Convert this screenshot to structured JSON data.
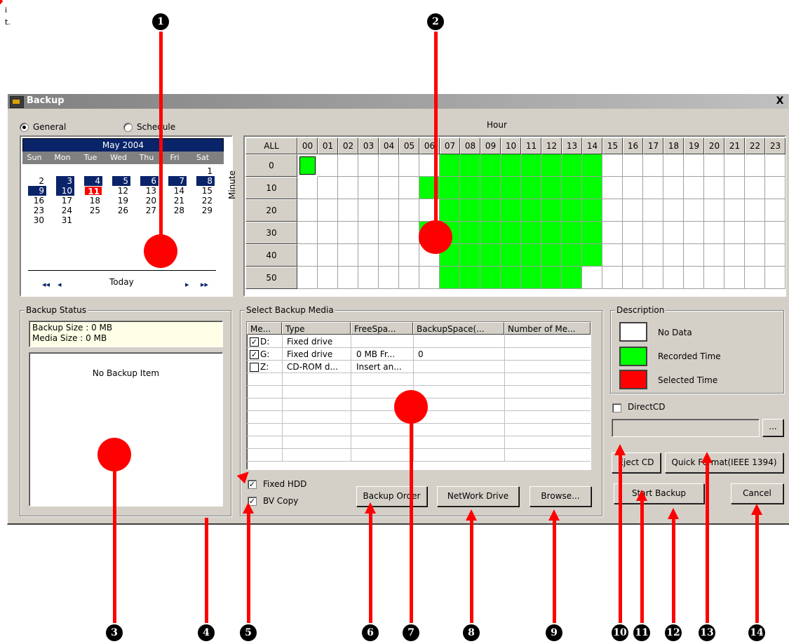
{
  "margin_note": "it.",
  "window": {
    "title": "Backup",
    "close_label": "X"
  },
  "mode": {
    "general_label": "General",
    "schedule_label": "Schedule",
    "selected": "General"
  },
  "calendar": {
    "month_label": "May 2004",
    "weekdays": [
      "Sun",
      "Mon",
      "Tue",
      "Wed",
      "Thu",
      "Fri",
      "Sat"
    ],
    "weeks": [
      [
        "",
        "",
        "",
        "",
        "",
        "",
        "1"
      ],
      [
        "2",
        "3",
        "4",
        "5",
        "6",
        "7",
        "8"
      ],
      [
        "9",
        "10",
        "11",
        "12",
        "13",
        "14",
        "15"
      ],
      [
        "16",
        "17",
        "18",
        "19",
        "20",
        "21",
        "22"
      ],
      [
        "23",
        "24",
        "25",
        "26",
        "27",
        "28",
        "29"
      ],
      [
        "30",
        "31",
        "",
        "",
        "",
        "",
        ""
      ]
    ],
    "selected_days": [
      "3",
      "4",
      "5",
      "6",
      "7",
      "8",
      "9",
      "10"
    ],
    "today": "11",
    "today_label": "Today",
    "nav": {
      "first": "◂◂",
      "prev": "◂",
      "next": "▸",
      "last": "▸▸"
    }
  },
  "hour_grid": {
    "hour_label": "Hour",
    "minute_label": "Minute",
    "all_label": "ALL",
    "hours": [
      "00",
      "01",
      "02",
      "03",
      "04",
      "05",
      "06",
      "07",
      "08",
      "09",
      "10",
      "11",
      "12",
      "13",
      "14",
      "15",
      "16",
      "17",
      "18",
      "19",
      "20",
      "21",
      "22",
      "23"
    ],
    "minutes": [
      "0",
      "10",
      "20",
      "30",
      "40",
      "50"
    ],
    "recorded": [
      [
        "00",
        "07",
        "08",
        "09",
        "10",
        "11",
        "12",
        "13",
        "14"
      ],
      [
        "06",
        "07",
        "08",
        "09",
        "10",
        "11",
        "12",
        "13",
        "14"
      ],
      [
        "07",
        "08",
        "09",
        "10",
        "11",
        "12",
        "13",
        "14"
      ],
      [
        "06",
        "07",
        "08",
        "09",
        "10",
        "11",
        "12",
        "13",
        "14"
      ],
      [
        "07",
        "08",
        "09",
        "10",
        "11",
        "12",
        "13",
        "14"
      ],
      [
        "07",
        "08",
        "09",
        "10",
        "11",
        "12",
        "13"
      ]
    ]
  },
  "backup_status": {
    "title": "Backup Status",
    "backup_size": "Backup Size : 0 MB",
    "media_size": "Media Size : 0 MB",
    "items_text": "No Backup Item"
  },
  "backup_media": {
    "title": "Select Backup Media",
    "columns": [
      "Me...",
      "Type",
      "FreeSpa...",
      "BackupSpace(...",
      "Number of Me..."
    ],
    "rows": [
      {
        "checked": true,
        "drive": "D:",
        "type": "Fixed drive",
        "free": "",
        "backup": "",
        "number": ""
      },
      {
        "checked": true,
        "drive": "G:",
        "type": "Fixed drive",
        "free": "0 MB Fr...",
        "backup": "0",
        "number": ""
      },
      {
        "checked": false,
        "drive": "Z:",
        "type": "CD-ROM d...",
        "free": "Insert an...",
        "backup": "",
        "number": ""
      }
    ],
    "fixed_hdd_label": "Fixed HDD",
    "bv_copy_label": "BV Copy",
    "backup_order_label": "Backup Order",
    "network_drive_label": "NetWork Drive",
    "browse_label": "Browse..."
  },
  "description": {
    "title": "Description",
    "items": [
      {
        "label": "No Data",
        "color": "#ffffff"
      },
      {
        "label": "Recorded Time",
        "color": "#00ff00"
      },
      {
        "label": "Selected Time",
        "color": "#ff0000"
      }
    ]
  },
  "directcd": {
    "label": "DirectCD",
    "browse_label": "..."
  },
  "actions": {
    "eject_cd": "Eject CD",
    "quick_format": "Quick Format(IEEE 1394)",
    "start_backup": "Start Backup",
    "cancel": "Cancel"
  },
  "callouts": {
    "numbers": [
      "1",
      "2",
      "3",
      "4",
      "5",
      "6",
      "7",
      "8",
      "9",
      "10",
      "11",
      "12",
      "13",
      "14"
    ],
    "color": "#ff0000"
  }
}
